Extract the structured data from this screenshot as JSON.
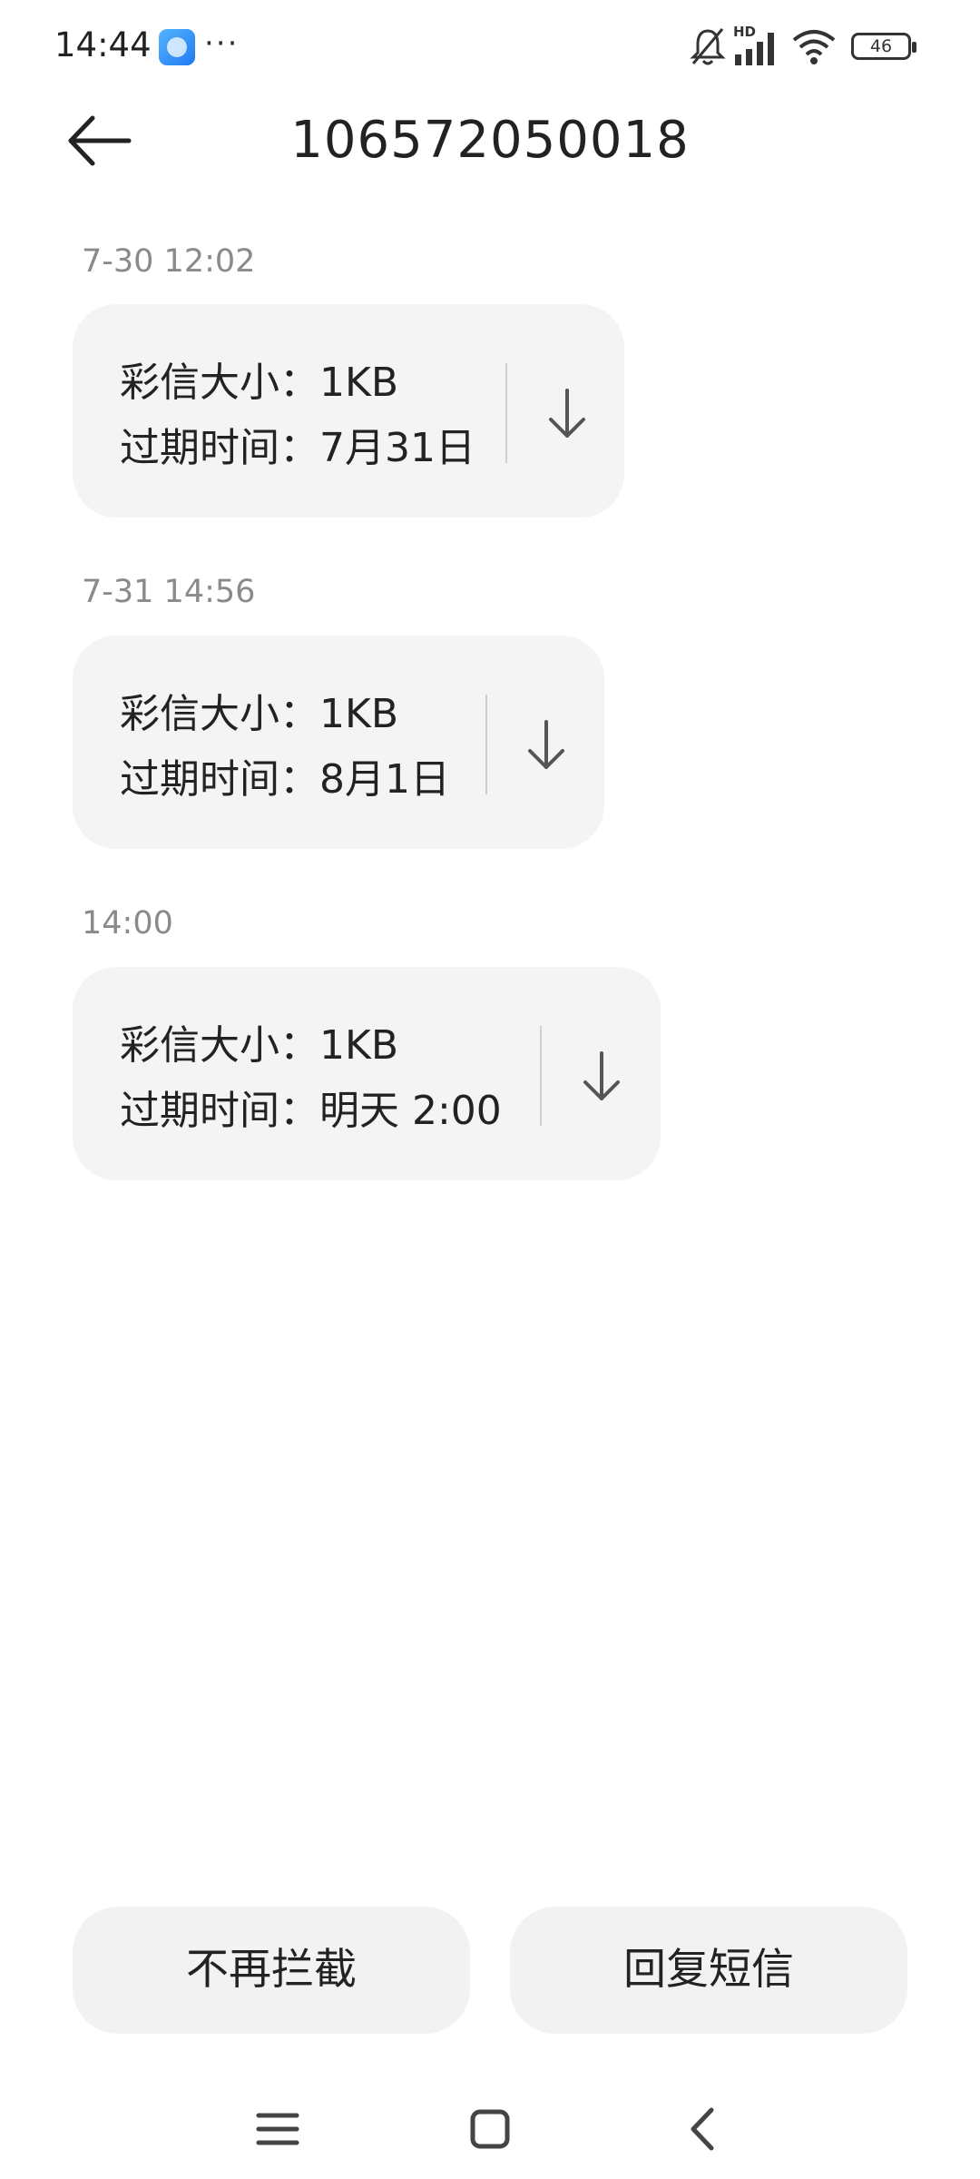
{
  "status_bar": {
    "time": "14:44",
    "dots": "···",
    "network_label": "HD",
    "battery": "46",
    "app_badge_icon": "browser-icon",
    "icons": [
      "mute-bell-icon",
      "signal-icon",
      "wifi-icon",
      "battery-icon"
    ]
  },
  "header": {
    "back_icon": "arrow-left-icon",
    "title": "106572050018"
  },
  "messages": [
    {
      "time": "7-30 12:02",
      "size_line": "彩信大小：1KB",
      "expire_line": "过期时间：7月31日",
      "action_icon": "download-arrow-icon"
    },
    {
      "time": "7-31 14:56",
      "size_line": "彩信大小：1KB",
      "expire_line": "过期时间：8月1日",
      "action_icon": "download-arrow-icon"
    },
    {
      "time": "14:00",
      "size_line": "彩信大小：1KB",
      "expire_line": "过期时间：明天 2:00",
      "action_icon": "download-arrow-icon"
    }
  ],
  "actions": {
    "unblock_label": "不再拦截",
    "reply_label": "回复短信"
  },
  "nav": {
    "items": [
      "menu-icon",
      "home-icon",
      "back-icon"
    ]
  },
  "colors": {
    "bubble": "#f4f4f4",
    "button": "#f2f2f2",
    "muted_text": "#8a8a8a",
    "text": "#222222"
  }
}
